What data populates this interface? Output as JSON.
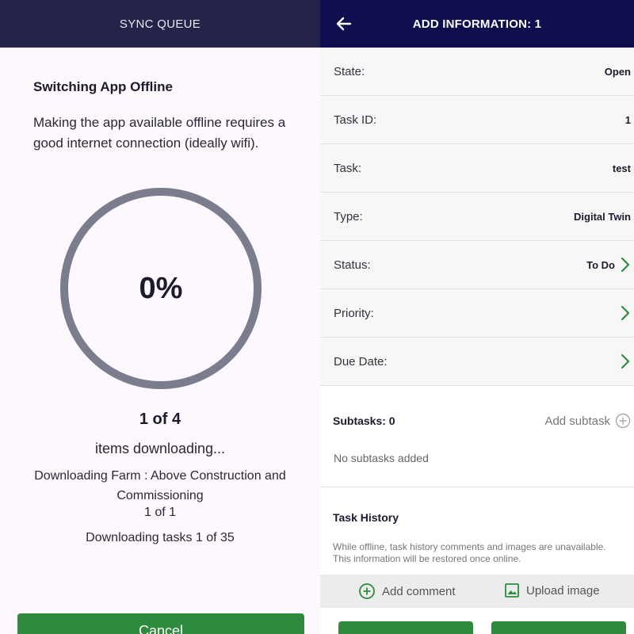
{
  "left": {
    "appbar_title": "SYNC QUEUE",
    "heading": "Switching App Offline",
    "description": "Making the app available offline requires a good internet connection (ideally wifi).",
    "progress_percent_text": "0%",
    "progress_value": 0,
    "items_count": "1 of 4",
    "items_status": "items downloading...",
    "farm_status": "Downloading Farm : Above Construction and Commissioning",
    "farm_count": "1 of 1",
    "tasks_status": "Downloading tasks 1 of 35",
    "cancel_label": "Cancel",
    "colors": {
      "ring": "#7b7d8f",
      "button": "#2e8b3d",
      "appbar": "#24244a"
    }
  },
  "right": {
    "appbar_title": "ADD INFORMATION: 1",
    "back_icon": "arrow-left-icon",
    "fields": [
      {
        "label": "State:",
        "value": "Open"
      },
      {
        "label": "Task ID:",
        "value": "1"
      },
      {
        "label": "Task:",
        "value": "test"
      },
      {
        "label": "Type:",
        "value": "Digital Twin"
      },
      {
        "label": "Status:",
        "value": "To Do"
      },
      {
        "label": "Priority:",
        "value": ""
      },
      {
        "label": "Due Date:",
        "value": ""
      }
    ],
    "subtasks": {
      "title": "Subtasks: 0",
      "add_label": "Add subtask",
      "empty_text": "No subtasks added"
    },
    "history": {
      "title": "Task History",
      "note": "While offline, task history comments and images are unavailable. This information will be restored once online."
    },
    "actions": {
      "comment_label": "Add comment",
      "upload_label": "Upload image"
    },
    "colors": {
      "appbar": "#0f0f50",
      "accent": "#2e8b3d"
    }
  }
}
